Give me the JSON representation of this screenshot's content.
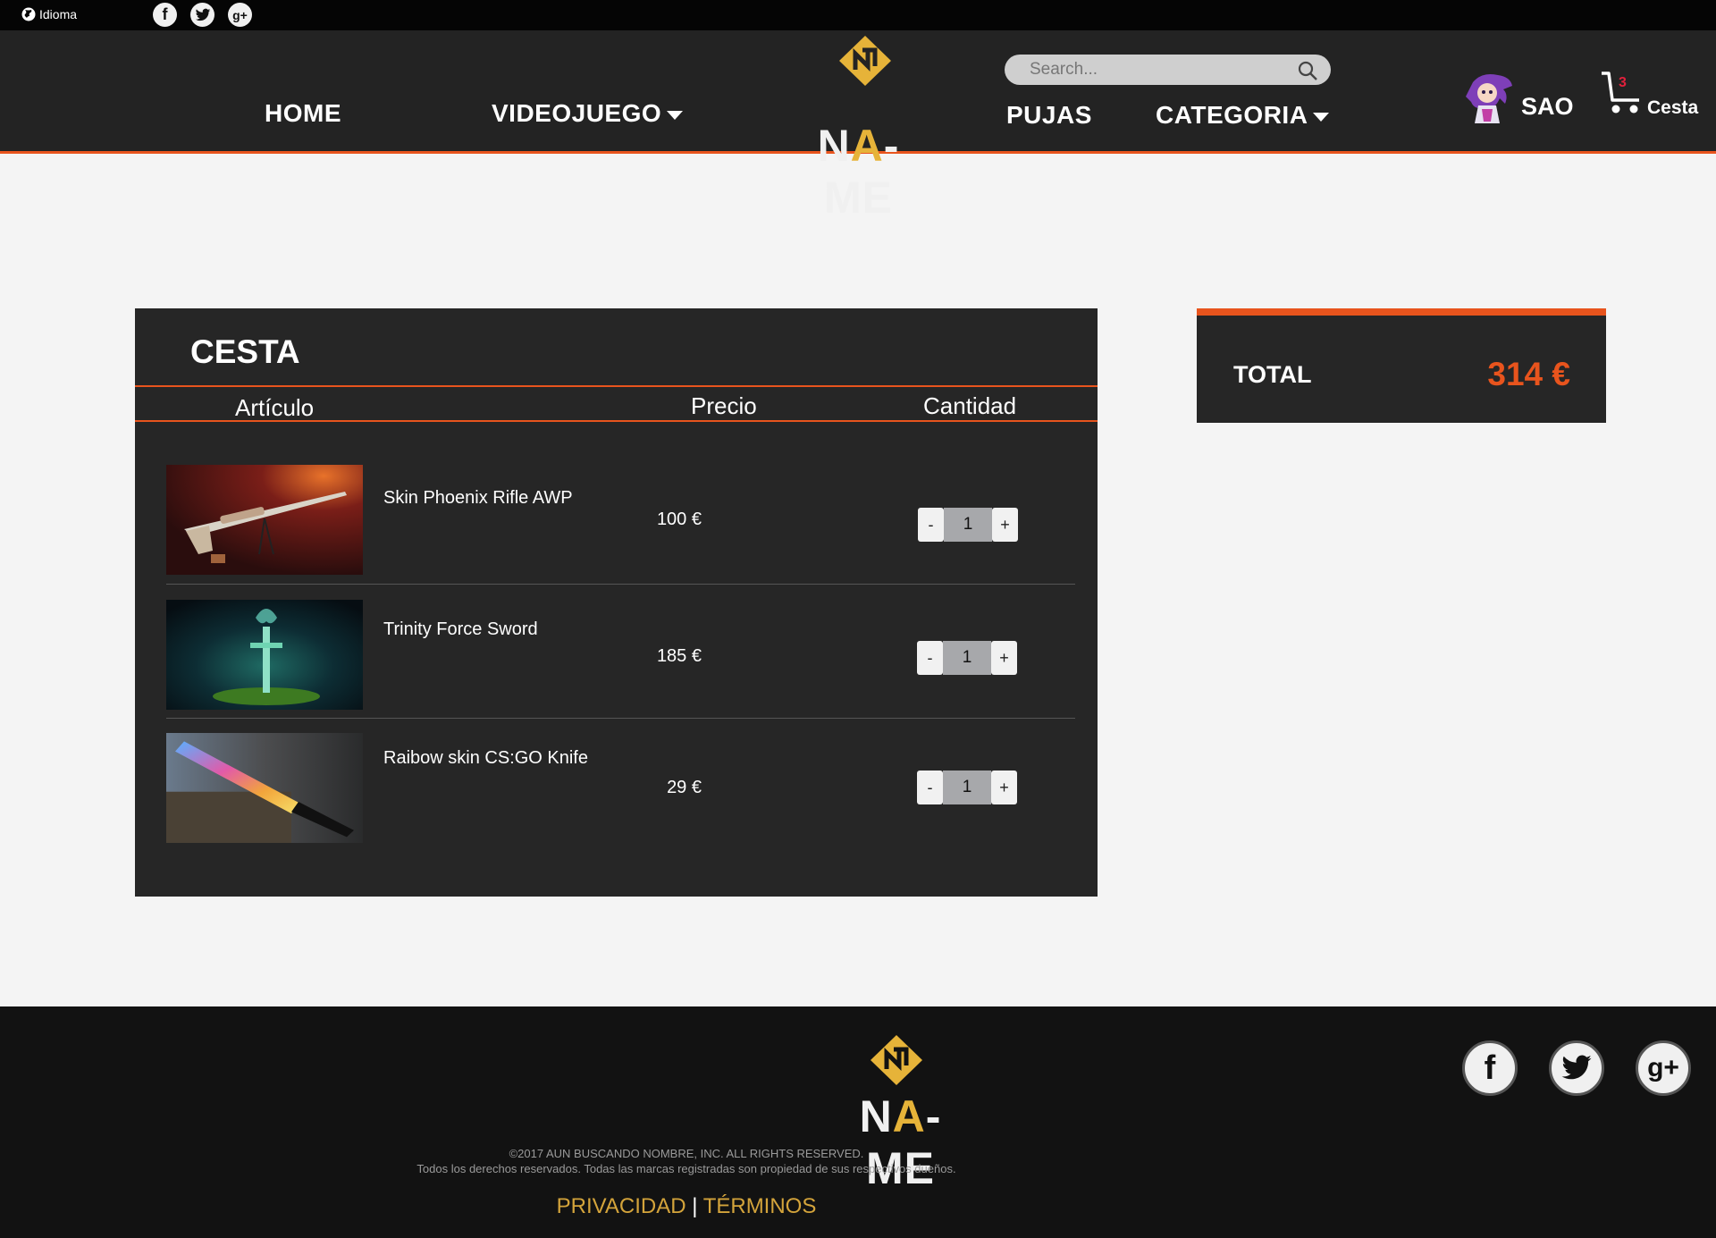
{
  "topbar": {
    "language_label": "Idioma",
    "social": [
      "facebook-icon",
      "twitter-icon",
      "google-plus-icon"
    ]
  },
  "header": {
    "nav": {
      "home": "HOME",
      "videojuego": "VIDEOJUEGO",
      "pujas": "PUJAS",
      "categoria": "CATEGORIA"
    },
    "logo": {
      "part1": "N",
      "part2": "A",
      "part3": "-ME"
    },
    "search": {
      "placeholder": "Search...",
      "value": ""
    },
    "user": {
      "name": "SAO"
    },
    "cart": {
      "count": "3",
      "label": "Cesta"
    }
  },
  "cart": {
    "title": "CESTA",
    "columns": {
      "article": "Artículo",
      "price": "Precio",
      "quantity": "Cantidad"
    },
    "items": [
      {
        "name": "Skin Phoenix Rifle AWP",
        "price": "100 €",
        "qty": "1",
        "minus": "-",
        "plus": "+"
      },
      {
        "name": "Trinity Force Sword",
        "price": "185 €",
        "qty": "1",
        "minus": "-",
        "plus": "+"
      },
      {
        "name": "Raibow skin CS:GO Knife",
        "price": "29 €",
        "qty": "1",
        "minus": "-",
        "plus": "+"
      }
    ]
  },
  "summary": {
    "total_label": "TOTAL",
    "total_value": "314 €"
  },
  "footer": {
    "logo": {
      "part1": "N",
      "part2": "A",
      "part3": "-ME"
    },
    "copyright": "©2017 AUN BUSCANDO NOMBRE, INC. ALL RIGHTS RESERVED.",
    "rights": "Todos los derechos reservados. Todas las marcas registradas son propiedad de sus respectivos dueños.",
    "privacy": "PRIVACIDAD",
    "separator": "|",
    "terms": "TÉRMINOS"
  },
  "colors": {
    "accent": "#e8541d",
    "gold": "#e6b339",
    "panel": "#262626",
    "header": "#232323",
    "footer": "#121212"
  }
}
